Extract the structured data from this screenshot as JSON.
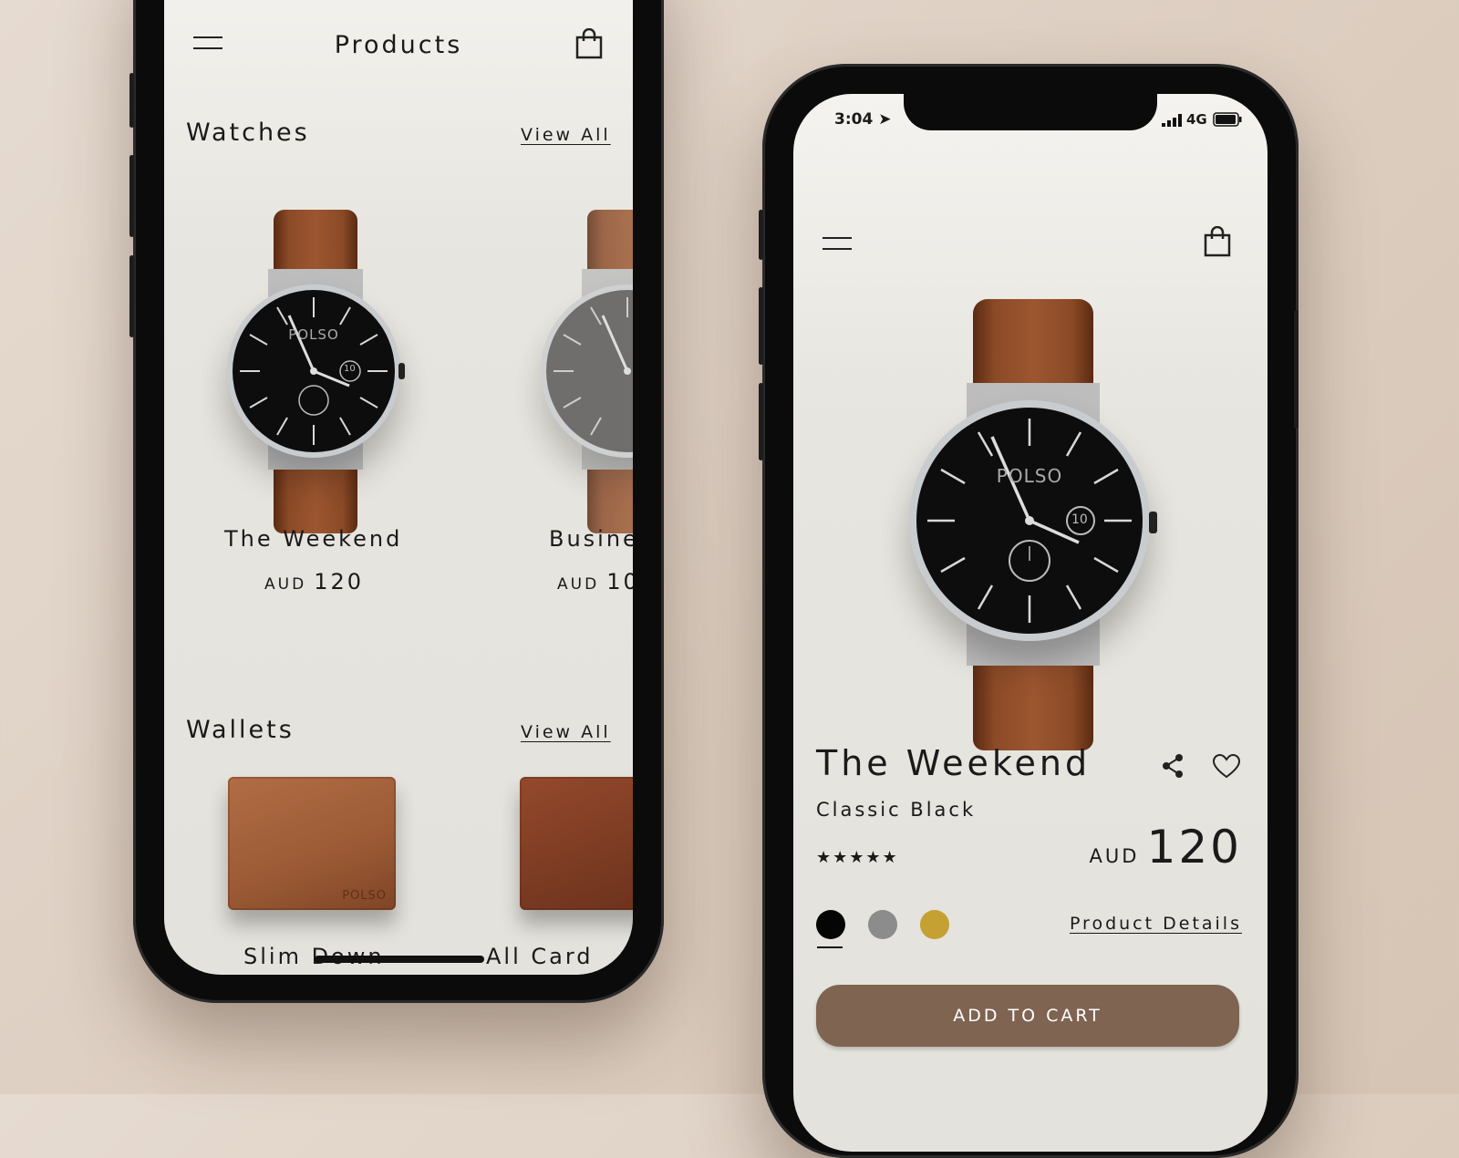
{
  "left_screen": {
    "title": "Products",
    "watches_heading": "Watches",
    "watches_view_all": "View All",
    "watches": [
      {
        "name": "The Weekend",
        "currency": "AUD",
        "price": "120"
      },
      {
        "name": "Busine",
        "currency": "AUD",
        "price": "10"
      }
    ],
    "wallets_heading": "Wallets",
    "wallets_view_all": "View All",
    "wallets": [
      {
        "name": "Slim Down",
        "logo": "POLSO"
      },
      {
        "name": "All Card"
      }
    ],
    "watch_brand": "POLSO",
    "date_window": "10"
  },
  "right_screen": {
    "status_time": "3:04",
    "network": "4G",
    "product_name": "The Weekend",
    "variant": "Classic Black",
    "currency": "AUD",
    "price": "120",
    "rating": 5,
    "stars": "★★★★★",
    "swatches": [
      "#050505",
      "#8c8c8c",
      "#c4a132"
    ],
    "selected_swatch": 0,
    "product_details_link": "Product Details",
    "add_to_cart": "ADD TO CART",
    "watch_brand": "POLSO",
    "date_window": "10"
  }
}
